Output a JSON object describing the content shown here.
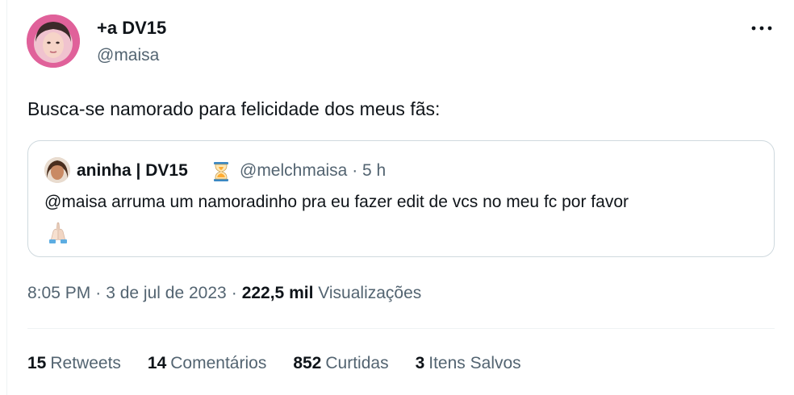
{
  "author": {
    "display_name": "+a DV15",
    "handle": "@maisa",
    "avatar_color": "#e0619a"
  },
  "more_icon": "more-horizontal-icon",
  "tweet": {
    "text": "Busca-se namorado para felicidade dos meus fãs:"
  },
  "quote": {
    "display_name": "aninha | DV15",
    "name_emoji": "hourglass-icon",
    "handle": "@melchmaisa",
    "dot": "·",
    "time": "5 h",
    "text": "@maisa arruma um namoradinho pra eu fazer edit de vcs no meu fc por favor",
    "trailing_emoji": "folded-hands-icon"
  },
  "meta": {
    "time": "8:05 PM",
    "dot1": "·",
    "date": "3 de jul de 2023",
    "dot2": "·",
    "views_count": "222,5 mil",
    "views_label": "Visualizações"
  },
  "stats": [
    {
      "count": "15",
      "label": "Retweets"
    },
    {
      "count": "14",
      "label": "Comentários"
    },
    {
      "count": "852",
      "label": "Curtidas"
    },
    {
      "count": "3",
      "label": "Itens Salvos"
    }
  ],
  "colors": {
    "primary_text": "#0f1419",
    "secondary_text": "#536471",
    "border": "#cfd9de",
    "divider": "#eff3f4"
  }
}
